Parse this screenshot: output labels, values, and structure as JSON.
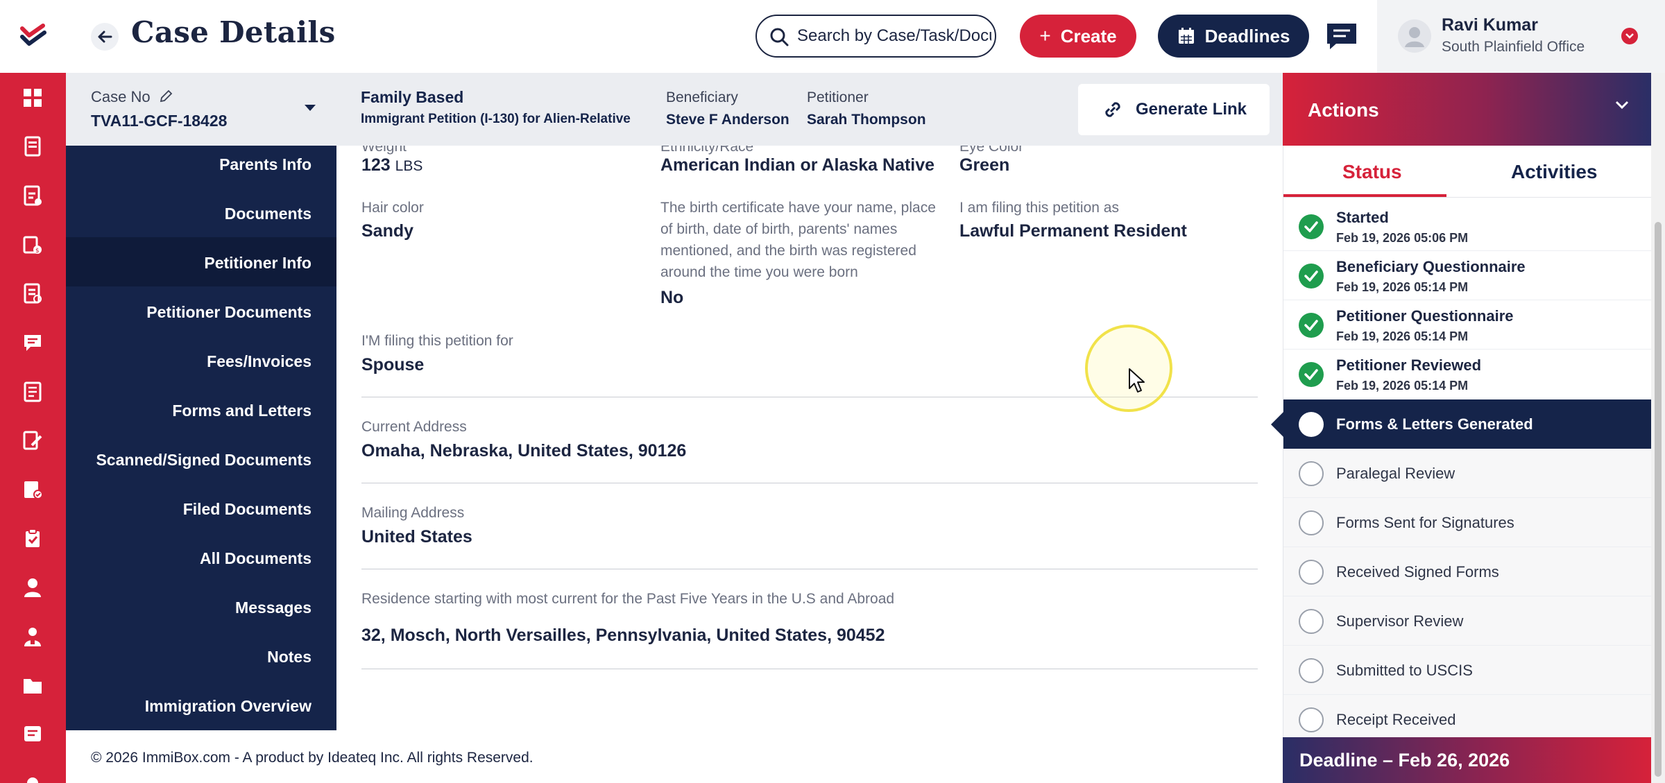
{
  "header": {
    "title": "Case Details",
    "search_placeholder": "Search by Case/Task/Document",
    "create_label": "Create",
    "deadlines_label": "Deadlines",
    "user_name": "Ravi Kumar",
    "user_office": "South Plainfield Office"
  },
  "case_bar": {
    "case_no_label": "Case No",
    "case_no": "TVA11-GCF-18428",
    "category": "Family Based",
    "petition_type": "Immigrant Petition (I-130) for Alien-Relative",
    "beneficiary_label": "Beneficiary",
    "beneficiary": "Steve F Anderson",
    "petitioner_label": "Petitioner",
    "petitioner": "Sarah Thompson",
    "generate_link_label": "Generate Link"
  },
  "actions": {
    "title": "Actions",
    "tab_status": "Status",
    "tab_activities": "Activities",
    "deadline": "Deadline – Feb 26, 2026",
    "steps": [
      {
        "title": "Started",
        "date": "Feb 19, 2026 05:06 PM",
        "state": "done"
      },
      {
        "title": "Beneficiary Questionnaire",
        "date": "Feb 19, 2026 05:14 PM",
        "state": "done"
      },
      {
        "title": "Petitioner Questionnaire",
        "date": "Feb 19, 2026 05:14 PM",
        "state": "done"
      },
      {
        "title": "Petitioner Reviewed",
        "date": "Feb 19, 2026 05:14 PM",
        "state": "done"
      },
      {
        "title": "Forms & Letters Generated",
        "state": "active"
      },
      {
        "title": "Paralegal Review",
        "state": "todo"
      },
      {
        "title": "Forms Sent for Signatures",
        "state": "todo"
      },
      {
        "title": "Received Signed Forms",
        "state": "todo"
      },
      {
        "title": "Supervisor Review",
        "state": "todo"
      },
      {
        "title": "Submitted to USCIS",
        "state": "todo"
      },
      {
        "title": "Receipt Received",
        "state": "todo"
      }
    ]
  },
  "sidenav": {
    "items": [
      "Parents Info",
      "Documents",
      "Petitioner Info",
      "Petitioner Documents",
      "Fees/Invoices",
      "Forms and Letters",
      "Scanned/Signed Documents",
      "Filed Documents",
      "All Documents",
      "Messages",
      "Notes",
      "Immigration Overview"
    ],
    "active_index": 2
  },
  "content": {
    "weight_label": "Weight",
    "weight_value": "123",
    "weight_unit": "LBS",
    "ethnicity_label": "Ethnicity/Race",
    "ethnicity_value": "American Indian or Alaska Native",
    "eye_label": "Eye Color",
    "eye_value": "Green",
    "hair_label": "Hair color",
    "hair_value": "Sandy",
    "birth_cert_label": "The birth certificate have your name, place of birth, date of birth, parents' names mentioned, and the birth was registered around the time you were born",
    "birth_cert_value": "No",
    "filing_as_label": "I am filing this petition as",
    "filing_as_value": "Lawful Permanent Resident",
    "filing_for_label": "I'M filing this petition for",
    "filing_for_value": "Spouse",
    "current_address_label": "Current Address",
    "current_address_value": "Omaha, Nebraska, United States, 90126",
    "mailing_address_label": "Mailing Address",
    "mailing_address_value": "United States",
    "residence_label": "Residence starting with most current for the Past Five Years in the U.S and Abroad",
    "residence_value": "32, Mosch, North Versailles, Pennsylvania, United States, 90452"
  },
  "footer": {
    "text": "© 2026 ImmiBox.com - A product by Ideateq Inc. All rights Reserved."
  },
  "colors": {
    "brand_red": "#d6223a",
    "brand_navy": "#15244a",
    "status_green": "#1f9d4e"
  }
}
